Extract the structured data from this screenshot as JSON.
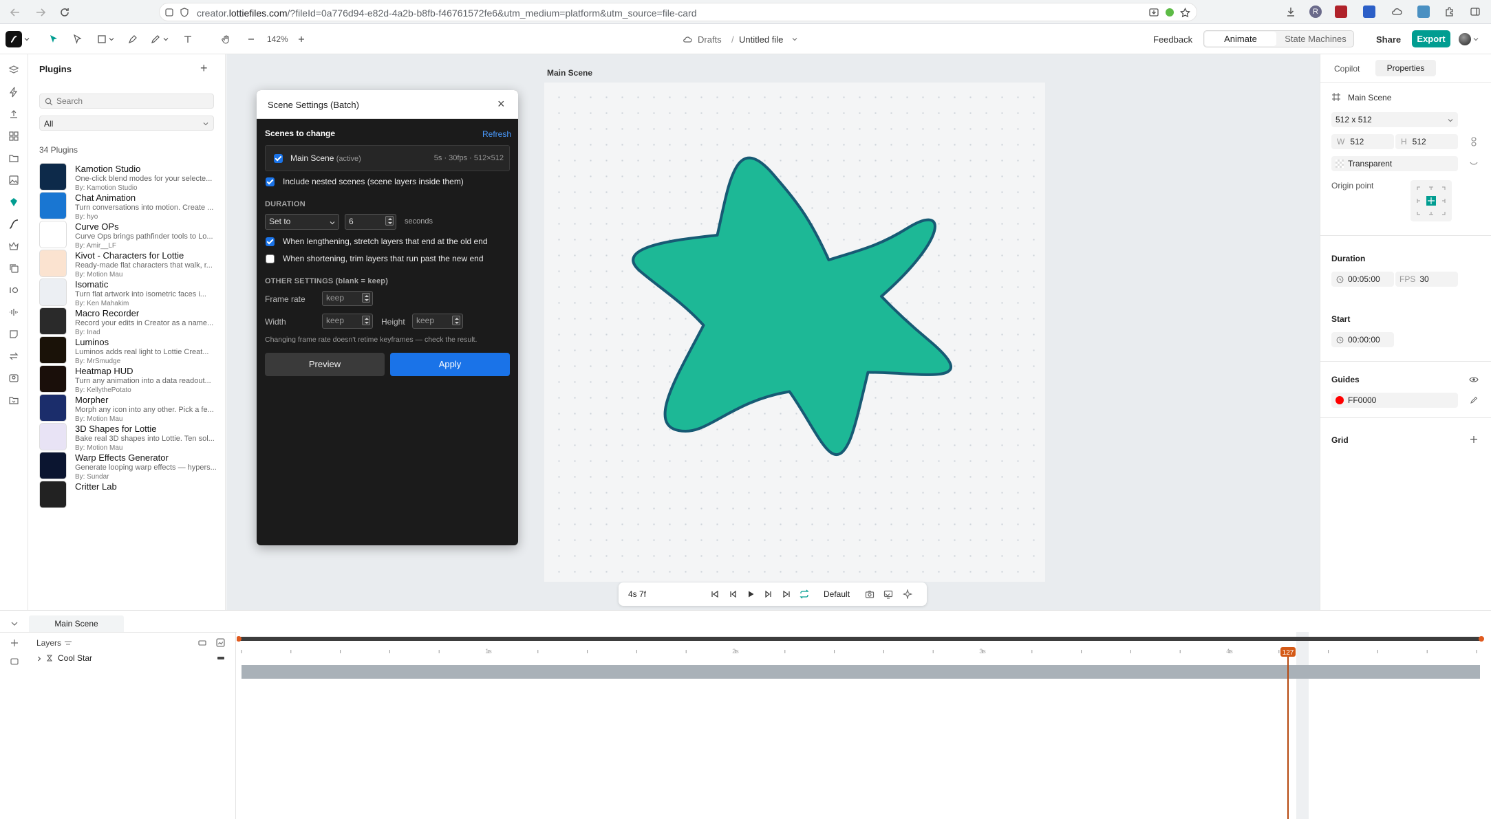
{
  "browser": {
    "url_prefix": "creator.",
    "url_host": "lottiefiles.com",
    "url_rest": "/?fileId=0a776d94-e82d-4a2b-b8fb-f46761572fe6&utm_medium=platform&utm_source=file-card"
  },
  "toolbar": {
    "zoom": "142%",
    "breadcrumb_folder": "Drafts",
    "breadcrumb_sep": "/",
    "file_name": "Untitled file",
    "feedback_label": "Feedback",
    "animate_label": "Animate",
    "state_machines_label": "State Machines",
    "share_label": "Share",
    "export_label": "Export"
  },
  "plugins": {
    "title": "Plugins",
    "search_placeholder": "Search",
    "filter_value": "All",
    "count": "34 Plugins",
    "items": [
      {
        "name": "Kamotion Studio",
        "desc": "One-click blend modes for your selecte...",
        "by": "By: Kamotion Studio",
        "color": "#0d2a4a"
      },
      {
        "name": "Chat Animation",
        "desc": "Turn conversations into motion. Create ...",
        "by": "By: hyo",
        "color": "#1976d2"
      },
      {
        "name": "Curve OPs",
        "desc": "Curve Ops brings pathfinder tools to Lo...",
        "by": "By: Amir__LF",
        "color": "#ffffff"
      },
      {
        "name": "Kivot - Characters for Lottie",
        "desc": "Ready-made flat characters that walk, r...",
        "by": "By: Motion Mau",
        "color": "#fbe3d0"
      },
      {
        "name": "Isomatic",
        "desc": "Turn flat artwork into isometric faces i...",
        "by": "By: Ken Mahakim",
        "color": "#eceff3"
      },
      {
        "name": "Macro Recorder",
        "desc": "Record your edits in Creator as a name...",
        "by": "By: Inad",
        "color": "#2a2a2a"
      },
      {
        "name": "Luminos",
        "desc": "Luminos adds real light to Lottie Creat...",
        "by": "By: MrSmudge",
        "color": "#1a1208"
      },
      {
        "name": "Heatmap HUD",
        "desc": "Turn any animation into a data readout...",
        "by": "By: KellythePotato",
        "color": "#1a0f0a"
      },
      {
        "name": "Morpher",
        "desc": "Morph any icon into any other. Pick a fe...",
        "by": "By: Motion Mau",
        "color": "#1b2d6b"
      },
      {
        "name": "3D Shapes for Lottie",
        "desc": "Bake real 3D shapes into Lottie. Ten sol...",
        "by": "By: Motion Mau",
        "color": "#e8e3f5"
      },
      {
        "name": "Warp Effects Generator",
        "desc": "Generate looping warp effects — hypers...",
        "by": "By: Sundar",
        "color": "#0b1530"
      },
      {
        "name": "Critter Lab",
        "desc": "",
        "by": "",
        "color": "#222222"
      }
    ]
  },
  "canvas": {
    "scene_label": "Main Scene",
    "star_fill": "#1db896",
    "star_stroke": "#175a74"
  },
  "playback": {
    "time": "4s 7f",
    "quality": "Default"
  },
  "dialog": {
    "title": "Scene Settings (Batch)",
    "scenes_heading": "Scenes to change",
    "refresh_label": "Refresh",
    "scene_name": "Main Scene",
    "scene_active": "(active)",
    "scene_meta": "5s · 30fps · 512×512",
    "include_nested": "Include nested scenes (scene layers inside them)",
    "duration_heading": "DURATION",
    "duration_mode": "Set to",
    "duration_value": "6",
    "duration_unit": "seconds",
    "stretch_label": "When lengthening, stretch layers that end at the old end",
    "trim_label": "When shortening, trim layers that run past the new end",
    "other_heading": "OTHER SETTINGS (blank = keep)",
    "frame_rate_label": "Frame rate",
    "keep_placeholder": "keep",
    "width_label": "Width",
    "height_label": "Height",
    "note": "Changing frame rate doesn't retime keyframes — check the result.",
    "preview_label": "Preview",
    "apply_label": "Apply"
  },
  "properties": {
    "tab_copilot": "Copilot",
    "tab_properties": "Properties",
    "scene_name": "Main Scene",
    "size_preset": "512 x 512",
    "w_label": "W",
    "w_value": "512",
    "h_label": "H",
    "h_value": "512",
    "background": "Transparent",
    "origin_label": "Origin point",
    "duration_heading": "Duration",
    "duration_value": "00:05:00",
    "fps_label": "FPS",
    "fps_value": "30",
    "start_heading": "Start",
    "start_value": "00:00:00",
    "guides_heading": "Guides",
    "guide_color": "FF0000",
    "grid_heading": "Grid"
  },
  "timeline": {
    "tab": "Main Scene",
    "layers_label": "Layers",
    "layer_name": "Cool Star",
    "ruler_labels": [
      "1s",
      "2s",
      "3s",
      "4s"
    ],
    "playhead_frame": "127"
  }
}
